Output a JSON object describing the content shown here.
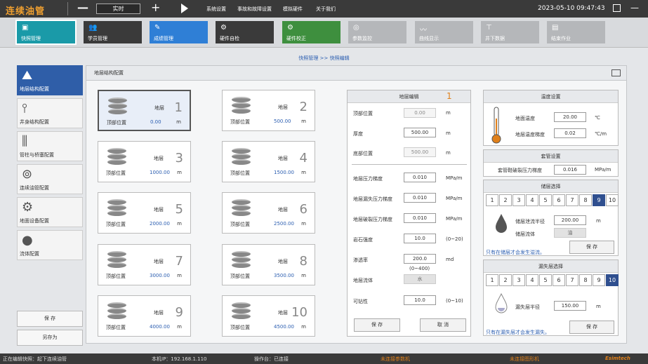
{
  "app": {
    "title": "连续油管",
    "mode": "实时",
    "datetime": "2023-05-10  09:47:43"
  },
  "menu": [
    "系统设置",
    "事故和故障设置",
    "模拟硬件",
    "关于我们"
  ],
  "toolbar": [
    {
      "label": "快照管理",
      "color": "#1a9aa8",
      "icon": "snapshot-icon",
      "active": true
    },
    {
      "label": "学员管理",
      "color": "#3a3a3a",
      "icon": "users-icon"
    },
    {
      "label": "成绩管理",
      "color": "#2f7fd6",
      "icon": "score-icon"
    },
    {
      "label": "硬件自检",
      "color": "#3a3a3a",
      "icon": "gear-icon"
    },
    {
      "label": "硬件校正",
      "color": "#3e8f3e",
      "icon": "gear-icon"
    },
    {
      "label": "参数监控",
      "color": "#b5b7ba",
      "icon": "monitor-icon"
    },
    {
      "label": "曲线显示",
      "color": "#b5b7ba",
      "icon": "curve-icon"
    },
    {
      "label": "井下数据",
      "color": "#b5b7ba",
      "icon": "well-icon"
    },
    {
      "label": "结束作业",
      "color": "#b5b7ba",
      "icon": "end-icon"
    }
  ],
  "breadcrumb": "快照管理 >> 快照编辑",
  "leftnav": [
    {
      "label": "地层结构配置",
      "icon": "strata-icon",
      "active": true
    },
    {
      "label": "井身结构配置",
      "icon": "wellbore-icon"
    },
    {
      "label": "管柱与桥塞配置",
      "icon": "pipe-icon"
    },
    {
      "label": "连续油管配置",
      "icon": "reel-icon"
    },
    {
      "label": "地面设备配置",
      "icon": "equipment-icon"
    },
    {
      "label": "流体配置",
      "icon": "drop-icon"
    }
  ],
  "leftbuttons": {
    "save": "保 存",
    "saveas": "另存为"
  },
  "panel_title": "地层结构配置",
  "layers": [
    {
      "name": "地层",
      "num": "1",
      "plabel": "顶部位置",
      "pos": "0.00",
      "unit": "m"
    },
    {
      "name": "地层",
      "num": "2",
      "plabel": "顶部位置",
      "pos": "500.00",
      "unit": "m"
    },
    {
      "name": "地层",
      "num": "3",
      "plabel": "顶部位置",
      "pos": "1000.00",
      "unit": "m"
    },
    {
      "name": "地层",
      "num": "4",
      "plabel": "顶部位置",
      "pos": "1500.00",
      "unit": "m"
    },
    {
      "name": "地层",
      "num": "5",
      "plabel": "顶部位置",
      "pos": "2000.00",
      "unit": "m"
    },
    {
      "name": "地层",
      "num": "6",
      "plabel": "顶部位置",
      "pos": "2500.00",
      "unit": "m"
    },
    {
      "name": "地层",
      "num": "7",
      "plabel": "顶部位置",
      "pos": "3000.00",
      "unit": "m"
    },
    {
      "name": "地层",
      "num": "8",
      "plabel": "顶部位置",
      "pos": "3500.00",
      "unit": "m"
    },
    {
      "name": "地层",
      "num": "9",
      "plabel": "顶部位置",
      "pos": "4000.00",
      "unit": "m"
    },
    {
      "name": "地层",
      "num": "10",
      "plabel": "顶部位置",
      "pos": "4500.00",
      "unit": "m"
    }
  ],
  "edit": {
    "title": "地层编辑",
    "num": "1",
    "top": {
      "label": "顶部位置",
      "value": "0.00",
      "unit": "m"
    },
    "thick": {
      "label": "厚度",
      "value": "500.00",
      "unit": "m"
    },
    "bottom": {
      "label": "底部位置",
      "value": "500.00",
      "unit": "m"
    },
    "pgrad": {
      "label": "地层压力梯度",
      "value": "0.010",
      "unit": "MPa/m"
    },
    "lgrad": {
      "label": "地层漏失压力梯度",
      "value": "0.010",
      "unit": "MPa/m"
    },
    "fgrad": {
      "label": "地层破裂压力梯度",
      "value": "0.010",
      "unit": "MPa/m"
    },
    "hard": {
      "label": "岩石强度",
      "value": "10.0",
      "unit": "(0~20)"
    },
    "perm": {
      "label": "渗透率",
      "value": "200.0",
      "unit": "md",
      "range": "(0~400)"
    },
    "fluid": {
      "label": "地层流体",
      "value": "水"
    },
    "visc": {
      "label": "可钻性",
      "value": "10.0",
      "unit": "(0~10)"
    },
    "save": "保 存",
    "cancel": "取 消"
  },
  "temp": {
    "title": "温度设置",
    "surf_label": "地面温度",
    "surf_value": "20.00",
    "surf_unit": "℃",
    "grad_label": "地层温度梯度",
    "grad_value": "0.02",
    "grad_unit": "℃/m"
  },
  "casing": {
    "title": "套管设置",
    "label": "套管鞋破裂压力梯度",
    "value": "0.016",
    "unit": "MPa/m"
  },
  "reservoir": {
    "title": "储层选择",
    "nums": [
      "1",
      "2",
      "3",
      "4",
      "5",
      "6",
      "7",
      "8",
      "9",
      "10"
    ],
    "selected": "9",
    "radius_label": "储层泄流半径",
    "radius_value": "200.00",
    "radius_unit": "m",
    "fluid_label": "储层流体",
    "fluid_value": "油",
    "note": "只有在储层才会发生溢流。",
    "save": "保 存"
  },
  "loss": {
    "title": "漏失层选择",
    "nums": [
      "1",
      "2",
      "3",
      "4",
      "5",
      "6",
      "7",
      "8",
      "9",
      "10"
    ],
    "selected": "10",
    "radius_label": "漏失层半径",
    "radius_value": "150.00",
    "radius_unit": "m",
    "note": "只有在漏失层才会发生漏失。",
    "save": "保 存"
  },
  "status": {
    "snapshot": "正在编辑快照：起下连续油管",
    "ip": "本机IP：192.168.1.110",
    "console": "操作台：已连接",
    "plc1": "未连接参数机",
    "plc2": "未连接图形机",
    "brand": "Esimtech"
  }
}
